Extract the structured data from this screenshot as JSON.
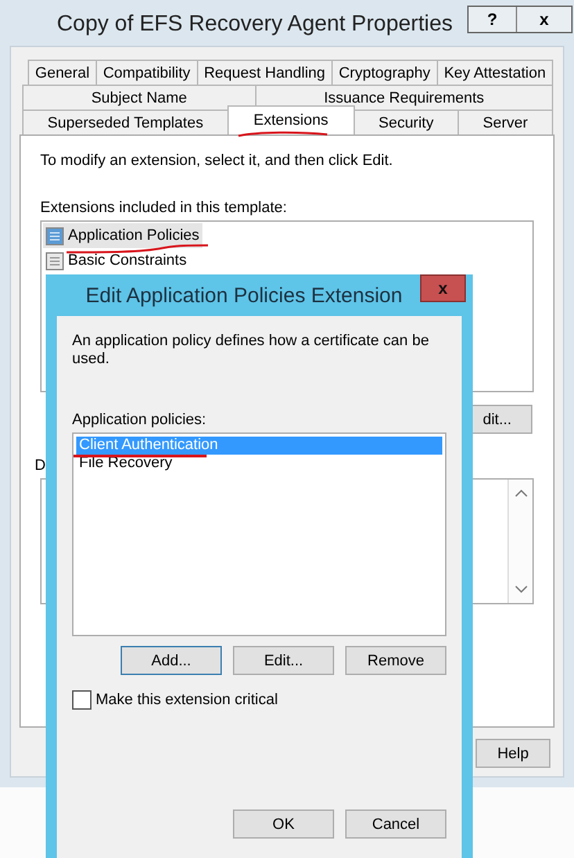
{
  "window": {
    "title": "Copy of EFS Recovery Agent Properties",
    "help_button": "?",
    "close_button": "x"
  },
  "tab_rows": [
    [
      {
        "label": "General",
        "selected": false
      },
      {
        "label": "Compatibility",
        "selected": false
      },
      {
        "label": "Request Handling",
        "selected": false
      },
      {
        "label": "Cryptography",
        "selected": false
      },
      {
        "label": "Key Attestation",
        "selected": false
      }
    ],
    [
      {
        "label": "Subject Name",
        "selected": false
      },
      {
        "label": "Issuance Requirements",
        "selected": false
      }
    ],
    [
      {
        "label": "Superseded Templates",
        "selected": false
      },
      {
        "label": "Extensions",
        "selected": true
      },
      {
        "label": "Security",
        "selected": false
      },
      {
        "label": "Server",
        "selected": false
      }
    ]
  ],
  "extensions_tab": {
    "instruction": "To modify an extension, select it, and then click Edit.",
    "list_label": "Extensions included in this template:",
    "extensions": [
      {
        "name": "Application Policies",
        "selected": true
      },
      {
        "name": "Basic Constraints",
        "selected": false
      }
    ],
    "edit_button": "dit...",
    "description_label": "D"
  },
  "footer_buttons": [
    "Help"
  ],
  "dialog": {
    "title": "Edit Application Policies Extension",
    "close_button": "x",
    "description": "An application policy defines how a certificate can be used.",
    "list_label": "Application policies:",
    "policies": [
      {
        "name": "Client Authentication",
        "selected": true
      },
      {
        "name": "File Recovery",
        "selected": false
      }
    ],
    "buttons": [
      "Add...",
      "Edit...",
      "Remove"
    ],
    "critical": {
      "label": "Make this extension critical",
      "checked": false
    },
    "footer_buttons": [
      "OK",
      "Cancel"
    ]
  }
}
